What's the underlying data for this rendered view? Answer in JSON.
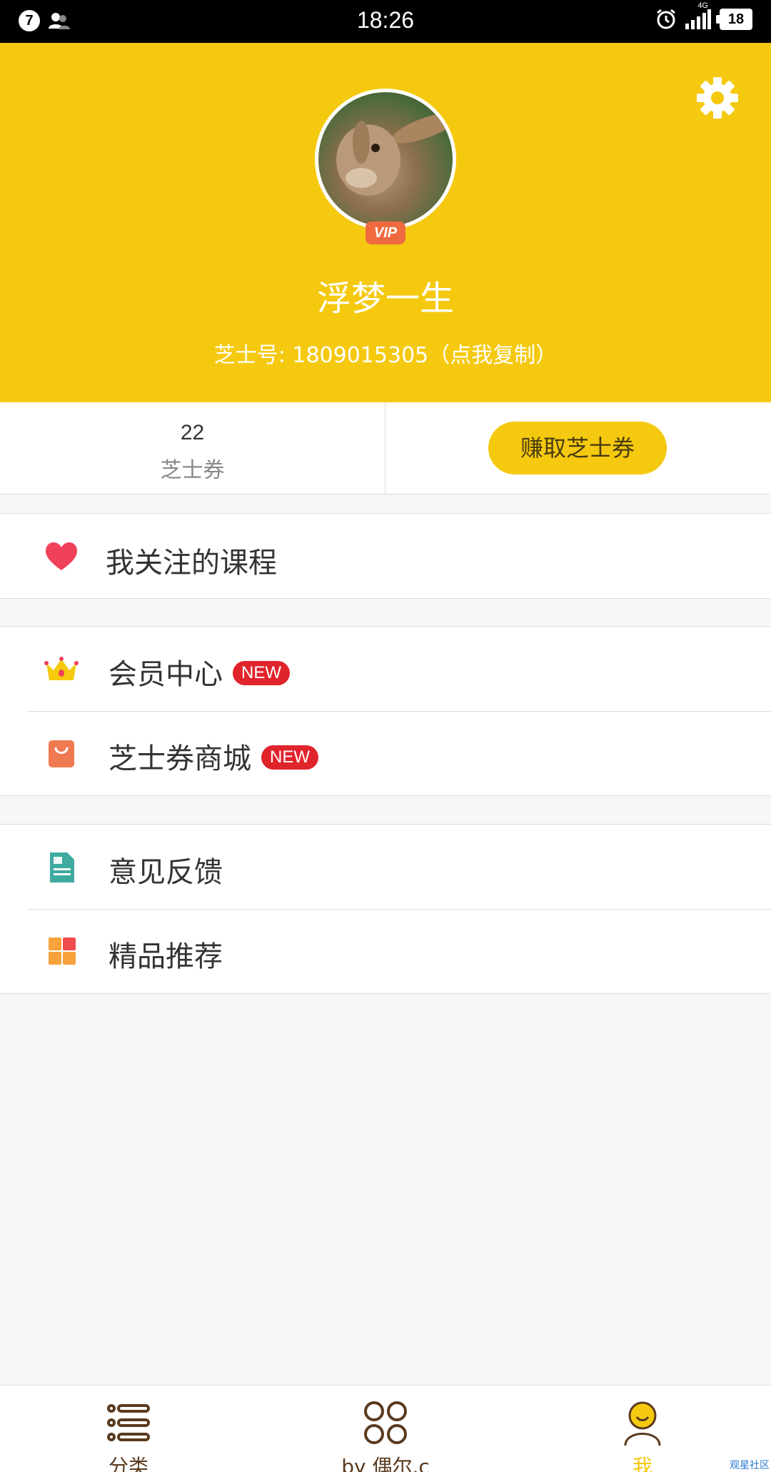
{
  "status_bar": {
    "notification_count": "7",
    "time": "18:26",
    "network": "4G",
    "battery": "18"
  },
  "profile": {
    "username": "浮梦一生",
    "vip_badge": "VIP",
    "id_line": "芝士号: 1809015305（点我复制）"
  },
  "stats": {
    "coupon_count": "22",
    "coupon_label": "芝士券",
    "earn_button": "赚取芝士券"
  },
  "menu": {
    "followed_courses": "我关注的课程",
    "member_center": "会员中心",
    "coupon_mall": "芝士券商城",
    "new_badge": "NEW",
    "feedback": "意见反馈",
    "recommend": "精品推荐"
  },
  "bottom_nav": {
    "tabs": [
      {
        "label": "分类",
        "icon": "list-icon"
      },
      {
        "label": "by 偶尔.c",
        "icon": "grid-circles-icon"
      },
      {
        "label": "我",
        "icon": "person-icon"
      }
    ]
  },
  "watermark": "观星社区",
  "colors": {
    "brand_yellow": "#f5c90f",
    "new_badge_red": "#e0242c",
    "vip_orange": "#ef6b3f",
    "nav_brown": "#5a3a1e"
  }
}
